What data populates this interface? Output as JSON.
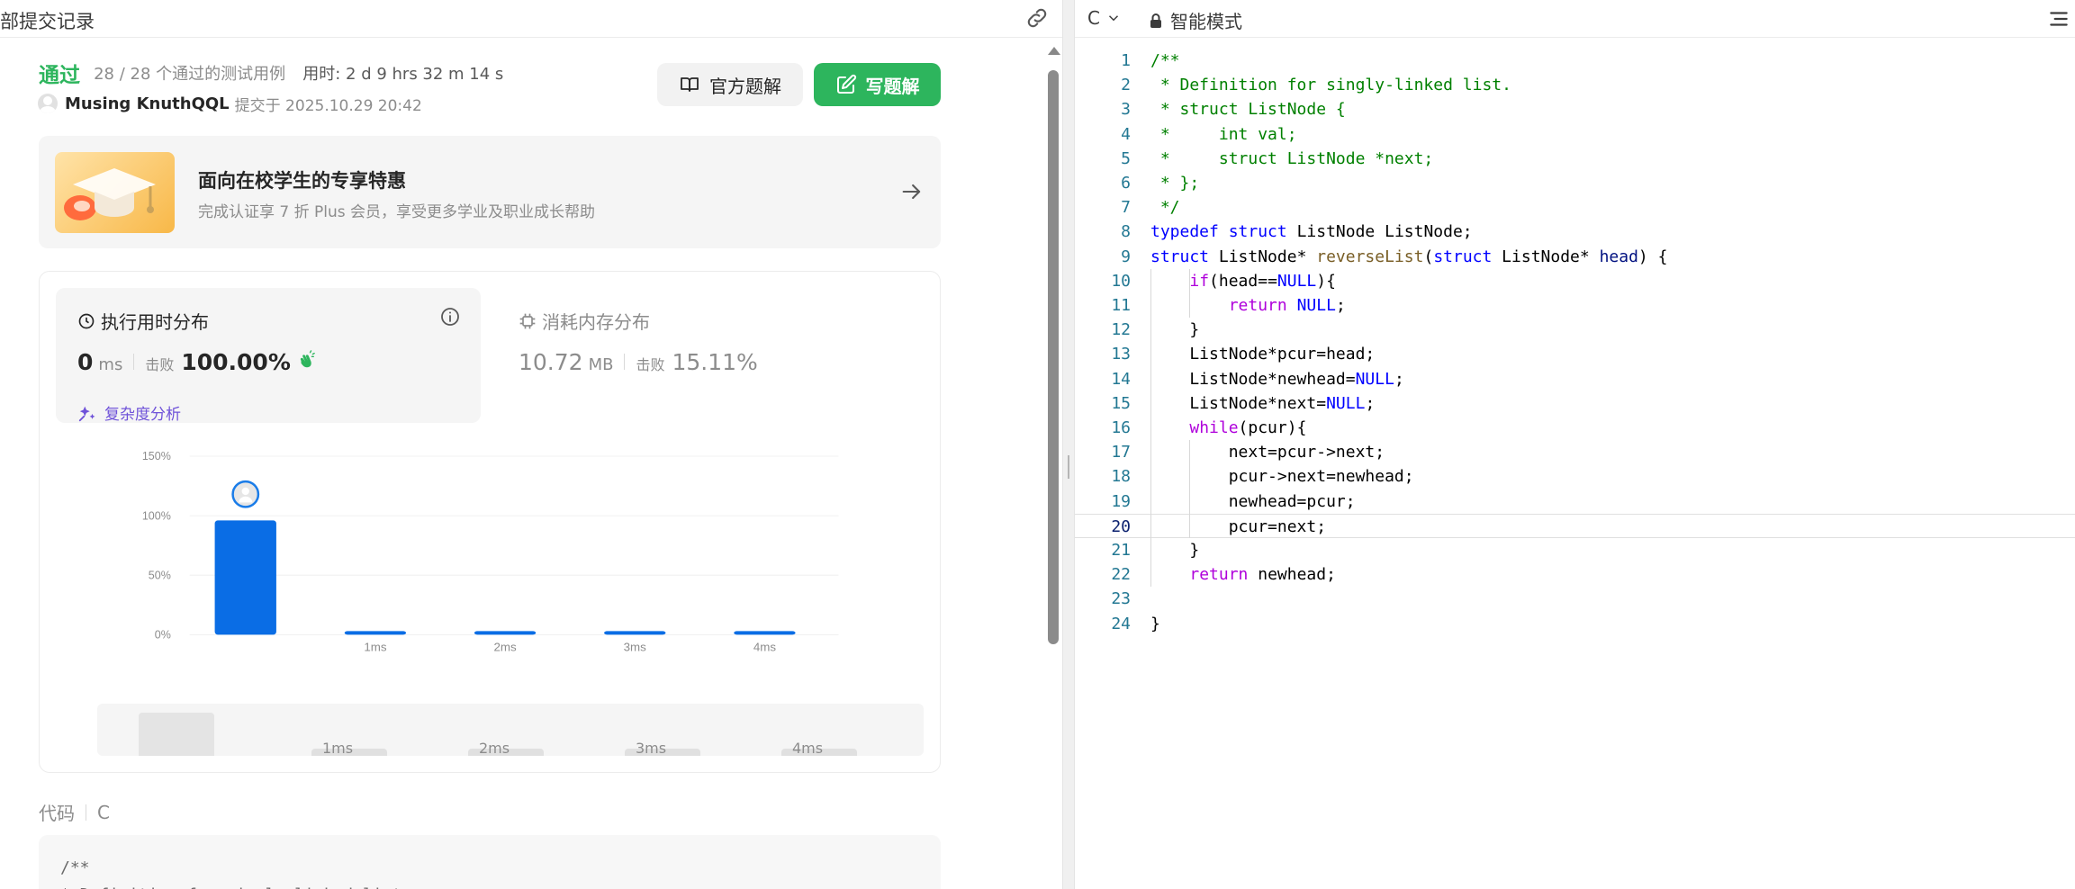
{
  "left_header": {
    "title": "部提交记录"
  },
  "submission": {
    "status": "通过",
    "cases": "28 / 28 个通过的测试用例",
    "time_label": "用时: 2 d 9 hrs 32 m 14 s",
    "author": "Musing KnuthQQL",
    "submitted": "提交于 2025.10.29 20:42"
  },
  "buttons": {
    "official": "官方题解",
    "write": "写题解"
  },
  "promo": {
    "title": "面向在校学生的专享特惠",
    "subtitle": "完成认证享 7 折 Plus 会员，享受更多学业及职业成长帮助"
  },
  "runtime": {
    "title": "执行用时分布",
    "value": "0",
    "unit": "ms",
    "beat_label": "击败",
    "beat_value": "100.00%",
    "complexity": "复杂度分析"
  },
  "memory": {
    "title": "消耗内存分布",
    "value": "10.72",
    "unit": "MB",
    "beat_label": "击败",
    "beat_value": "15.11%"
  },
  "chart_data": {
    "type": "bar",
    "categories": [
      "",
      "1ms",
      "2ms",
      "3ms",
      "4ms"
    ],
    "values": [
      96,
      3,
      3,
      3,
      3
    ],
    "y_ticks": [
      "0%",
      "50%",
      "100%",
      "150%"
    ],
    "ylim": [
      0,
      150
    ],
    "grid": true,
    "bar_color": "#0a6de5",
    "highlight_index": 0
  },
  "minimap": {
    "labels": [
      "1ms",
      "2ms",
      "3ms",
      "4ms"
    ]
  },
  "code_section": {
    "label": "代码",
    "lang": "C",
    "preview_line1": "/**",
    "preview_line2": " * Definition for singly-linked list."
  },
  "editor_header": {
    "lang": "C",
    "mode": "智能模式"
  },
  "editor": {
    "active_line": 20,
    "lines": [
      "/**",
      " * Definition for singly-linked list.",
      " * struct ListNode {",
      " *     int val;",
      " *     struct ListNode *next;",
      " * };",
      " */",
      "typedef struct ListNode ListNode;",
      "struct ListNode* reverseList(struct ListNode* head) {",
      "    if(head==NULL){",
      "        return NULL;",
      "    }",
      "    ListNode*pcur=head;",
      "    ListNode*newhead=NULL;",
      "    ListNode*next=NULL;",
      "    while(pcur){",
      "        next=pcur->next;",
      "        pcur->next=newhead;",
      "        newhead=pcur;",
      "        pcur=next;",
      "    }",
      "    return newhead;",
      "",
      "}"
    ]
  }
}
